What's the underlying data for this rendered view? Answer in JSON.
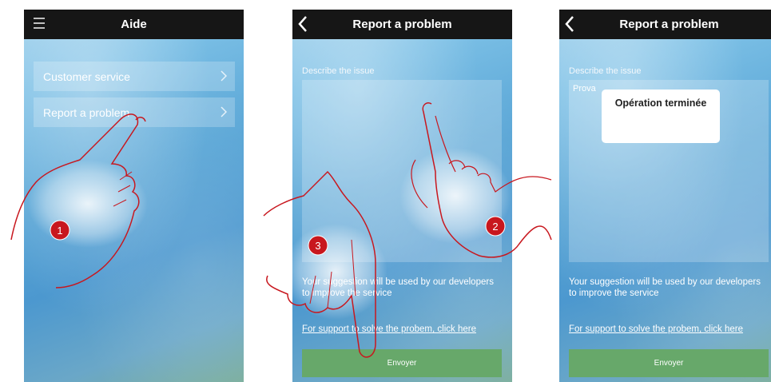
{
  "screen1": {
    "title": "Aide",
    "menu_items": [
      {
        "label": "Customer service"
      },
      {
        "label": "Report a problem"
      }
    ]
  },
  "screen2": {
    "title": "Report a problem",
    "describe_label": "Describe the issue",
    "textarea_value": "",
    "info_text": "Your suggestion will be used by our developers to improve the service",
    "support_link": "For support to solve the probem, click here",
    "send_label": "Envoyer"
  },
  "screen3": {
    "title": "Report a problem",
    "describe_label": "Describe the issue",
    "textarea_value": "Prova",
    "toast": "Opération terminée",
    "info_text": "Your suggestion will be used by our developers to improve the service",
    "support_link": "For support to solve the probem, click here",
    "send_label": "Envoyer"
  },
  "step_badges": [
    "1",
    "2",
    "3"
  ],
  "colors": {
    "topbar": "#161616",
    "send_button": "#67a86a",
    "badge": "#c8171e",
    "hand_outline": "#c8171e"
  }
}
